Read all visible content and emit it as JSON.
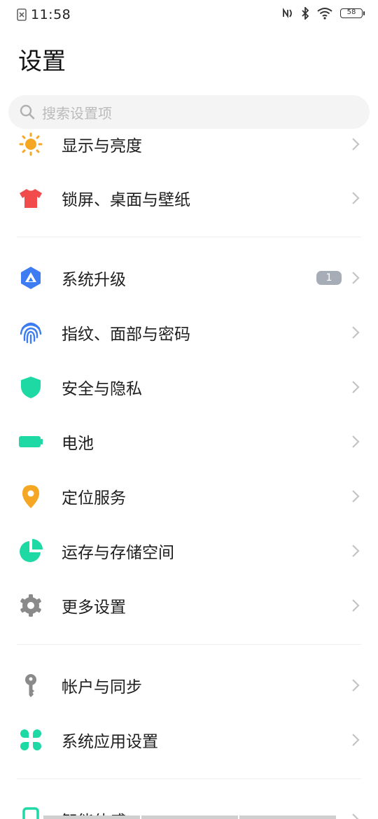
{
  "status_bar": {
    "time": "11:58",
    "battery": "58",
    "icons": [
      "notification-icon",
      "nfc-icon",
      "bluetooth-icon",
      "wifi-icon",
      "battery-icon"
    ]
  },
  "page": {
    "title": "设置"
  },
  "search": {
    "placeholder": "搜索设置项"
  },
  "groups": [
    {
      "items": [
        {
          "label": "显示与亮度",
          "icon": "sun-icon",
          "color": "#f5a623"
        },
        {
          "label": "锁屏、桌面与壁纸",
          "icon": "tshirt-icon",
          "color": "#f24b4b"
        }
      ]
    },
    {
      "items": [
        {
          "label": "系统升级",
          "icon": "system-update-icon",
          "color": "#3d7cf2",
          "badge": "1"
        },
        {
          "label": "指纹、面部与密码",
          "icon": "fingerprint-icon",
          "color": "#3d7cf2"
        },
        {
          "label": "安全与隐私",
          "icon": "shield-icon",
          "color": "#1ed9a4"
        },
        {
          "label": "电池",
          "icon": "battery-icon",
          "color": "#1ed9a4"
        },
        {
          "label": "定位服务",
          "icon": "location-pin-icon",
          "color": "#f5a623"
        },
        {
          "label": "运存与存储空间",
          "icon": "pie-chart-icon",
          "color": "#1ed9a4"
        },
        {
          "label": "更多设置",
          "icon": "gear-icon",
          "color": "#8a8a8a"
        }
      ]
    },
    {
      "items": [
        {
          "label": "帐户与同步",
          "icon": "key-icon",
          "color": "#8a8a8a"
        },
        {
          "label": "系统应用设置",
          "icon": "apps-grid-icon",
          "color": "#1ed9a4"
        }
      ]
    },
    {
      "items": [
        {
          "label": "智能体感",
          "icon": "phone-icon",
          "color": "#1ed9a4"
        }
      ]
    }
  ]
}
